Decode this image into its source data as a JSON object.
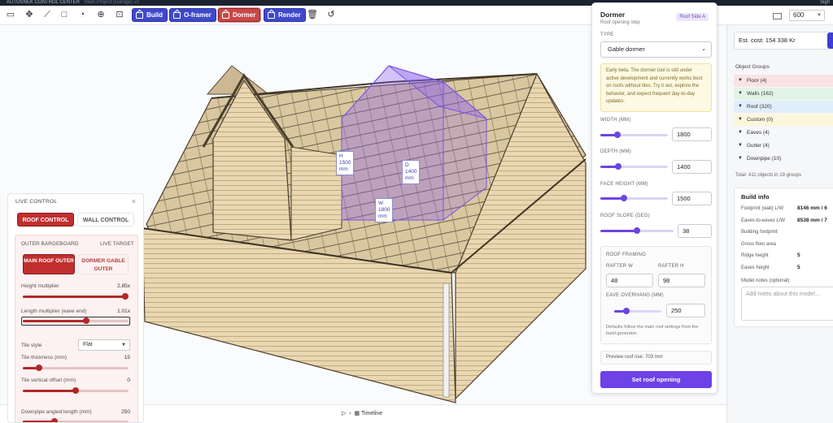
{
  "app": {
    "title": "AUTOSNEK CONTROL CENTER",
    "subtitle": "Main Project (Garage) v2",
    "signin": "Sign"
  },
  "toolbar": {
    "build_label": "Build",
    "oframer_label": "O-framer",
    "dormer_label": "Dormer",
    "render_label": "Render",
    "zoom_value": "600"
  },
  "colors": {
    "accent_blue": "#3f49c9",
    "accent_red": "#c12e2e",
    "accent_purple": "#6d42e6"
  },
  "viewport": {
    "dim_labels": {
      "h": [
        "H",
        "1500",
        "mm"
      ],
      "d": [
        "D",
        "1400",
        "mm"
      ],
      "w": [
        "W",
        "1800",
        "mm"
      ]
    },
    "timeline_label": "Timeline"
  },
  "live_control": {
    "title": "LIVE CONTROL",
    "tabs": [
      "ROOF CONTROL",
      "WALL CONTROL"
    ],
    "outer_bargeboard": "OUTER BARGEBOARD",
    "live_target": "LIVE TARGET",
    "targets": [
      "MAIN ROOF OUTER",
      "DORMER GABLE OUTER"
    ],
    "height_multiplier": {
      "label": "Height multiplier",
      "value": "2.85x",
      "fraction": 0.97
    },
    "length_multiplier": {
      "label": "Length multiplier (eave end)",
      "value": "1.01x",
      "fraction": 0.6
    },
    "tile_style": {
      "label": "Tile style",
      "value": "Flat"
    },
    "tile_thickness": {
      "label": "Tile thickness (mm)",
      "value": "15",
      "fraction": 0.15
    },
    "tile_offset": {
      "label": "Tile vertical offset (mm)",
      "value": "0",
      "fraction": 0.5
    },
    "downpipe_length": {
      "label": "Downpipe angled length (mm)",
      "value": "250",
      "fraction": 0.3
    }
  },
  "dormer_panel": {
    "title": "Dormer",
    "subtitle": "Roof opening step",
    "badge": "Roof Side A",
    "type_label": "TYPE",
    "type_value": "Gable dormer",
    "beta_note": "Early beta. The dormer tool is still under active development and currently works best on roofs without tiles. Try it out, explore the behavior, and expect frequent day-to-day updates.",
    "width": {
      "label": "WIDTH (MM)",
      "value": "1800",
      "fraction": 0.25
    },
    "depth": {
      "label": "DEPTH (MM)",
      "value": "1400",
      "fraction": 0.27
    },
    "face_height": {
      "label": "FACE HEIGHT (MM)",
      "value": "1500",
      "fraction": 0.35
    },
    "roof_slope": {
      "label": "ROOF SLOPE (DEG)",
      "value": "38",
      "fraction": 0.5
    },
    "framing": {
      "title": "ROOF FRAMING",
      "rafter_w_label": "RAFTER W",
      "rafter_w": "48",
      "rafter_h_label": "RAFTER H",
      "rafter_h": "98",
      "eave_label": "EAVE OVERHANG (MM)",
      "eave_value": "250",
      "eave_fraction": 0.25,
      "note": "Defaults follow the main roof settings from the build generator."
    },
    "preview": "Preview roof rise: 703 mm",
    "set_button": "Set roof opening"
  },
  "sidebar": {
    "cost": "Est. cost: 154 338 Kr",
    "object_groups_title": "Object Groups",
    "groups": [
      {
        "label": "Floor (4)",
        "color": "#fbe3e3",
        "chev": "▼"
      },
      {
        "label": "Walls (162)",
        "color": "#e2f4e6",
        "chev": "▼"
      },
      {
        "label": "Roof (320)",
        "color": "#e1eefb",
        "chev": "▼"
      },
      {
        "label": "Custom (0)",
        "color": "#fdf6dc",
        "chev": "▼"
      },
      {
        "label": "Eaves (4)",
        "color": "#f6f7f9",
        "chev": "▼"
      },
      {
        "label": "Gutter (4)",
        "color": "#f6f7f9",
        "chev": "▼"
      },
      {
        "label": "Downpipe (10)",
        "color": "#f6f7f9",
        "chev": "▼"
      }
    ],
    "total": "Total: 411 objects in 19 groups",
    "build_info": {
      "title": "Build info",
      "rows": [
        {
          "label": "Footprint (wall) L/W",
          "value": "8146 mm / 6"
        },
        {
          "label": "Eaves-to-eaves L/W",
          "value": "8538 mm / 7"
        },
        {
          "label": "Building footprint",
          "value": ""
        },
        {
          "label": "Gross floor area",
          "value": ""
        },
        {
          "label": "Ridge height",
          "value": "5"
        },
        {
          "label": "Eaves height",
          "value": "5"
        }
      ],
      "notes_label": "Model notes (optional)",
      "notes_placeholder": "Add notes about this model..."
    }
  }
}
